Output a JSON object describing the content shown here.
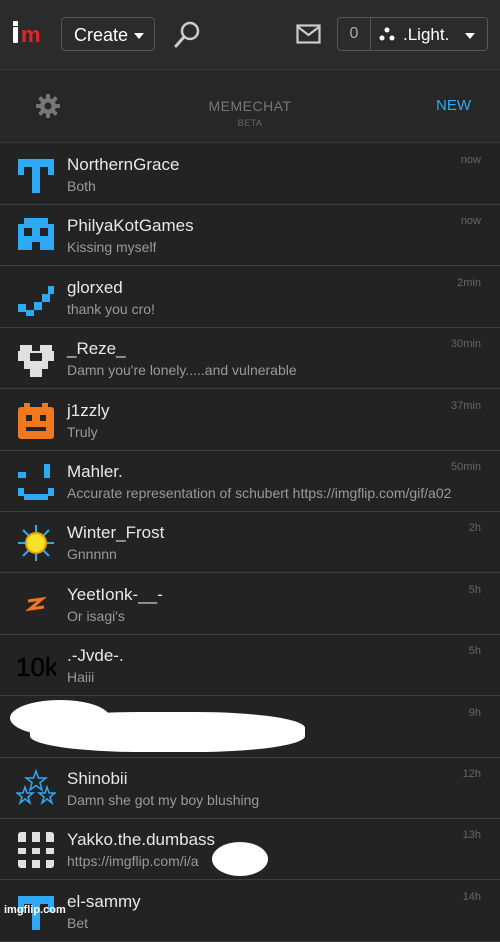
{
  "header": {
    "logo_text": "im",
    "create_label": "Create",
    "notification_count": "0",
    "username": ".Light."
  },
  "chat": {
    "title": "MEMECHAT",
    "badge": "BETA",
    "new_label": "NEW"
  },
  "conversations": [
    {
      "name": "NorthernGrace",
      "message": "Both",
      "time": "now",
      "avatar": "blue-cross-icon"
    },
    {
      "name": "PhilyaKotGames",
      "message": "Kissing myself",
      "time": "now",
      "avatar": "blue-mask-icon"
    },
    {
      "name": "glorxed",
      "message": "thank you cro!",
      "time": "2min",
      "avatar": "blue-check-icon"
    },
    {
      "name": "_Reze_",
      "message": "Damn you're lonely.....and vulnerable",
      "time": "30min",
      "avatar": "white-heart-icon"
    },
    {
      "name": "j1zzly",
      "message": "Truly",
      "time": "37min",
      "avatar": "orange-face-icon"
    },
    {
      "name": "Mahler.",
      "message": "Accurate representation of schubert https://imgflip.com/gif/a02",
      "time": "50min",
      "avatar": "blue-smile-icon"
    },
    {
      "name": "Winter_Frost",
      "message": "Gnnnnn",
      "time": "2h",
      "avatar": "sun-icon"
    },
    {
      "name": "YeetIonk-__-",
      "message": "Or isagi's",
      "time": "5h",
      "avatar": "orange-lightning-icon"
    },
    {
      "name": ".-Jvde-.",
      "message": "Haiii",
      "time": "5h",
      "avatar": "10k-text-icon",
      "avatar_text": "10k"
    },
    {
      "name": "",
      "message": "",
      "time": "9h",
      "avatar": "redacted"
    },
    {
      "name": "Shinobii",
      "message": "Damn she got my boy blushing",
      "time": "12h",
      "avatar": "stars-icon"
    },
    {
      "name": "Yakko.the.dumbass",
      "message": "https://imgflip.com/i/a",
      "time": "13h",
      "avatar": "white-grid-icon"
    },
    {
      "name": "el-sammy",
      "message": "Bet",
      "time": "14h",
      "avatar": "blue-cross-icon"
    }
  ],
  "watermark": "imgflip.com",
  "colors": {
    "accent": "#2ea9f5",
    "logo_red": "#e22",
    "background": "#232323"
  }
}
